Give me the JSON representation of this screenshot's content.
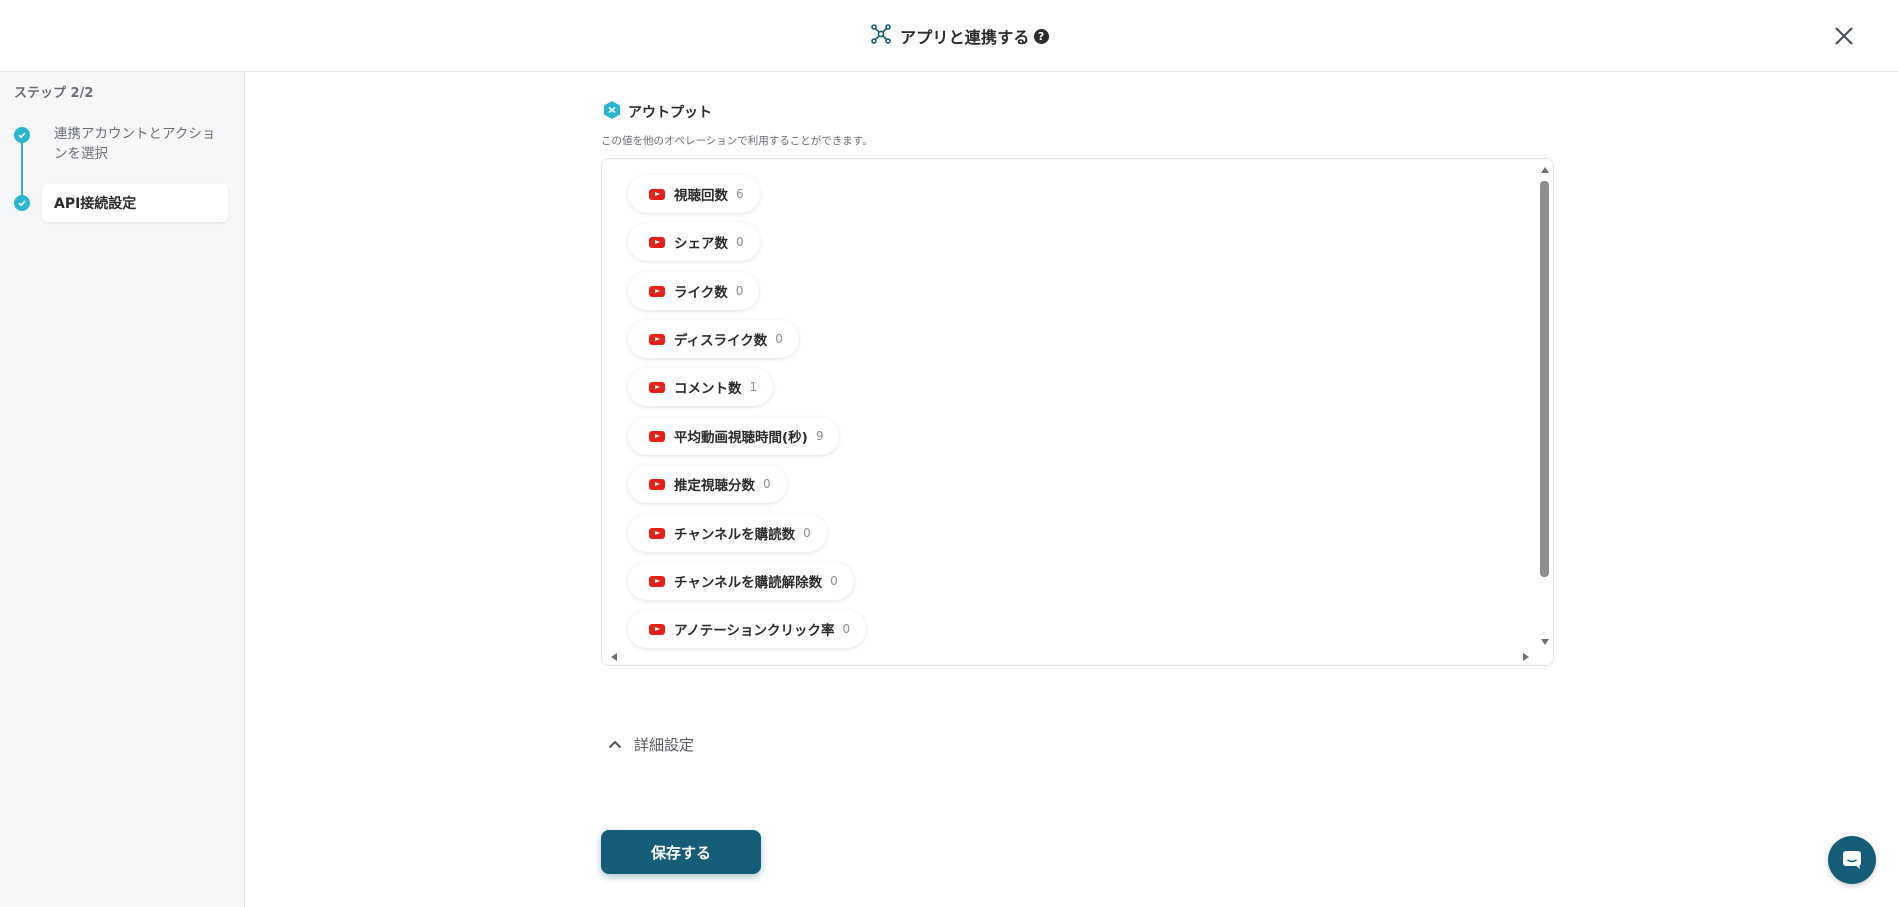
{
  "header": {
    "title": "アプリと連携する",
    "help_icon": "question-circle-icon",
    "app_icon": "network-nodes-icon",
    "close_icon": "close-icon"
  },
  "sidebar": {
    "step_heading": "ステップ 2/2",
    "steps": [
      {
        "label": "連携アカウントとアクションを選択",
        "status": "completed"
      },
      {
        "label": "API接続設定",
        "status": "current"
      }
    ]
  },
  "output": {
    "title": "アウトプット",
    "description": "この値を他のオペレーションで利用することができます。",
    "items": [
      {
        "label": "視聴回数",
        "value": "6"
      },
      {
        "label": "シェア数",
        "value": "0"
      },
      {
        "label": "ライク数",
        "value": "0"
      },
      {
        "label": "ディスライク数",
        "value": "0"
      },
      {
        "label": "コメント数",
        "value": "1"
      },
      {
        "label": "平均動画視聴時間(秒)",
        "value": "9"
      },
      {
        "label": "推定視聴分数",
        "value": "0"
      },
      {
        "label": "チャンネルを購読数",
        "value": "0"
      },
      {
        "label": "チャンネルを購読解除数",
        "value": "0"
      },
      {
        "label": "アノテーションクリック率",
        "value": "0"
      }
    ]
  },
  "advanced": {
    "label": "詳細設定"
  },
  "actions": {
    "save_label": "保存する"
  },
  "colors": {
    "accent": "#29b6d1",
    "primary": "#155d76",
    "youtube": "#e62117"
  }
}
